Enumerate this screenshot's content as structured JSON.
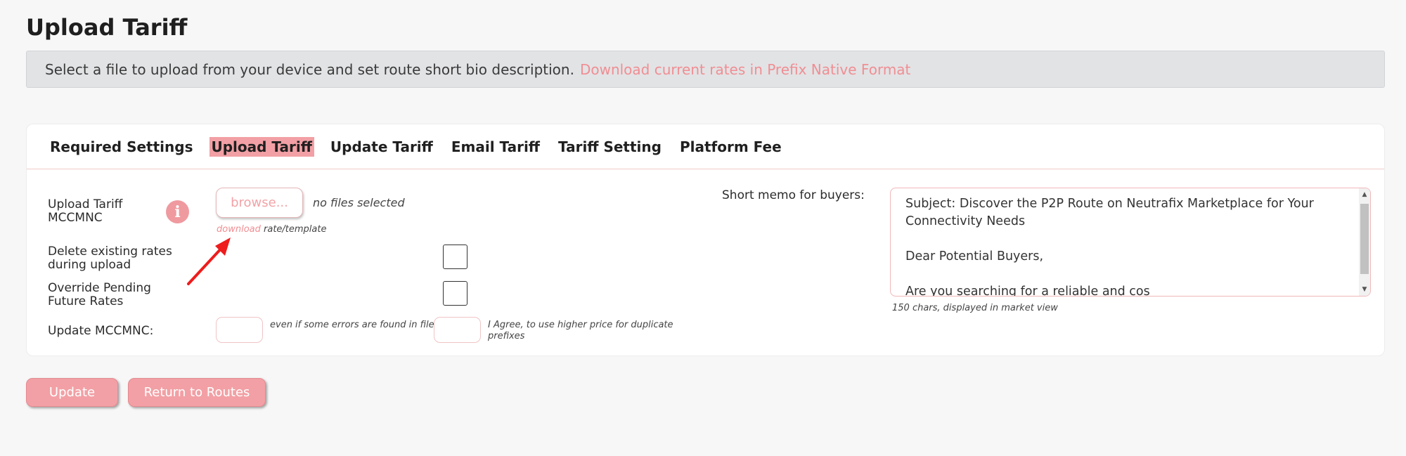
{
  "page": {
    "title": "Upload Tariff"
  },
  "info_bar": {
    "text": "Select a file to upload from your device and set route short bio description.",
    "link": "Download current rates in Prefix Native Format"
  },
  "tabs": [
    {
      "label": "Required Settings",
      "active": false
    },
    {
      "label": "Upload Tariff",
      "active": true
    },
    {
      "label": "Update Tariff",
      "active": false
    },
    {
      "label": "Email Tariff",
      "active": false
    },
    {
      "label": "Tariff Setting",
      "active": false
    },
    {
      "label": "Platform Fee",
      "active": false
    }
  ],
  "form": {
    "upload_label": "Upload Tariff\nMCCMNC",
    "info_icon": "i",
    "browse_label": "browse...",
    "no_files": "no files selected",
    "download_link": "download",
    "download_rest": " rate/template",
    "delete_label": "Delete existing rates\nduring upload",
    "override_label": "Override Pending\nFuture Rates",
    "update_mccmnc_label": "Update MCCMNC:",
    "errors_note": "even if some errors are found in file",
    "agree_note": "I Agree, to use higher price for duplicate\nprefixes"
  },
  "memo": {
    "label": "Short memo for buyers:",
    "value": "Subject: Discover the P2P Route on Neutrafix Marketplace for Your Connectivity Needs\n\nDear Potential Buyers,\n\nAre you searching for a reliable and cos",
    "chars_note": "150 chars, displayed in market view"
  },
  "buttons": {
    "update": "Update",
    "return": "Return to Routes"
  },
  "colors": {
    "accent": "#f2a0a5",
    "link": "#f08e93",
    "annotation_arrow": "#ee1c1c"
  }
}
